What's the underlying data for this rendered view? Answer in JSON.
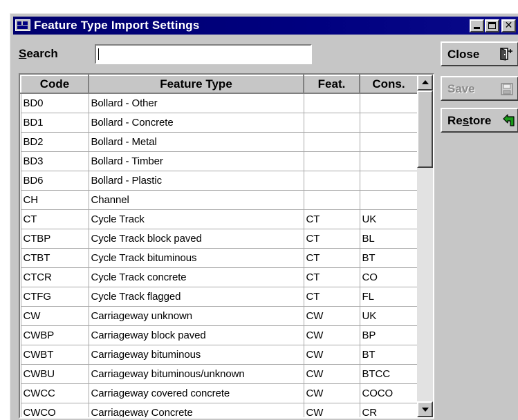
{
  "window": {
    "title": "Feature Type Import Settings",
    "close_glyph": "✕"
  },
  "search": {
    "label": "Search",
    "mnemonic": "S",
    "label_rest": "earch",
    "value": ""
  },
  "buttons": {
    "close": {
      "label": "Close",
      "icon": "door-exit-icon"
    },
    "save": {
      "label": "Save",
      "icon": "floppy-disk-icon",
      "enabled": false
    },
    "restore": {
      "label_pre": "Re",
      "mnemonic": "s",
      "label_post": "tore",
      "icon": "green-return-arrow-icon"
    }
  },
  "table": {
    "columns": [
      "Code",
      "Feature Type",
      "Feat.",
      "Cons."
    ],
    "rows": [
      [
        "BD0",
        "Bollard - Other",
        "",
        ""
      ],
      [
        "BD1",
        "Bollard - Concrete",
        "",
        ""
      ],
      [
        "BD2",
        "Bollard - Metal",
        "",
        ""
      ],
      [
        "BD3",
        "Bollard - Timber",
        "",
        ""
      ],
      [
        "BD6",
        "Bollard - Plastic",
        "",
        ""
      ],
      [
        "CH",
        "Channel",
        "",
        ""
      ],
      [
        "CT",
        "Cycle Track",
        "CT",
        "UK"
      ],
      [
        "CTBP",
        "Cycle Track block paved",
        "CT",
        "BL"
      ],
      [
        "CTBT",
        "Cycle Track bituminous",
        "CT",
        "BT"
      ],
      [
        "CTCR",
        "Cycle Track concrete",
        "CT",
        "CO"
      ],
      [
        "CTFG",
        "Cycle Track flagged",
        "CT",
        "FL"
      ],
      [
        "CW",
        "Carriageway unknown",
        "CW",
        "UK"
      ],
      [
        "CWBP",
        "Carriageway block paved",
        "CW",
        "BP"
      ],
      [
        "CWBT",
        "Carriageway bituminous",
        "CW",
        "BT"
      ],
      [
        "CWBU",
        "Carriageway bituminous/unknown",
        "CW",
        "BTCC"
      ],
      [
        "CWCC",
        "Carriageway covered concrete",
        "CW",
        "COCO"
      ],
      [
        "CWCO",
        "Carriageway Concrete",
        "CW",
        "CR"
      ]
    ]
  },
  "colors": {
    "titlebar": "#000080",
    "face": "#c6c6c6",
    "restore_arrow": "#1a9a1a"
  }
}
